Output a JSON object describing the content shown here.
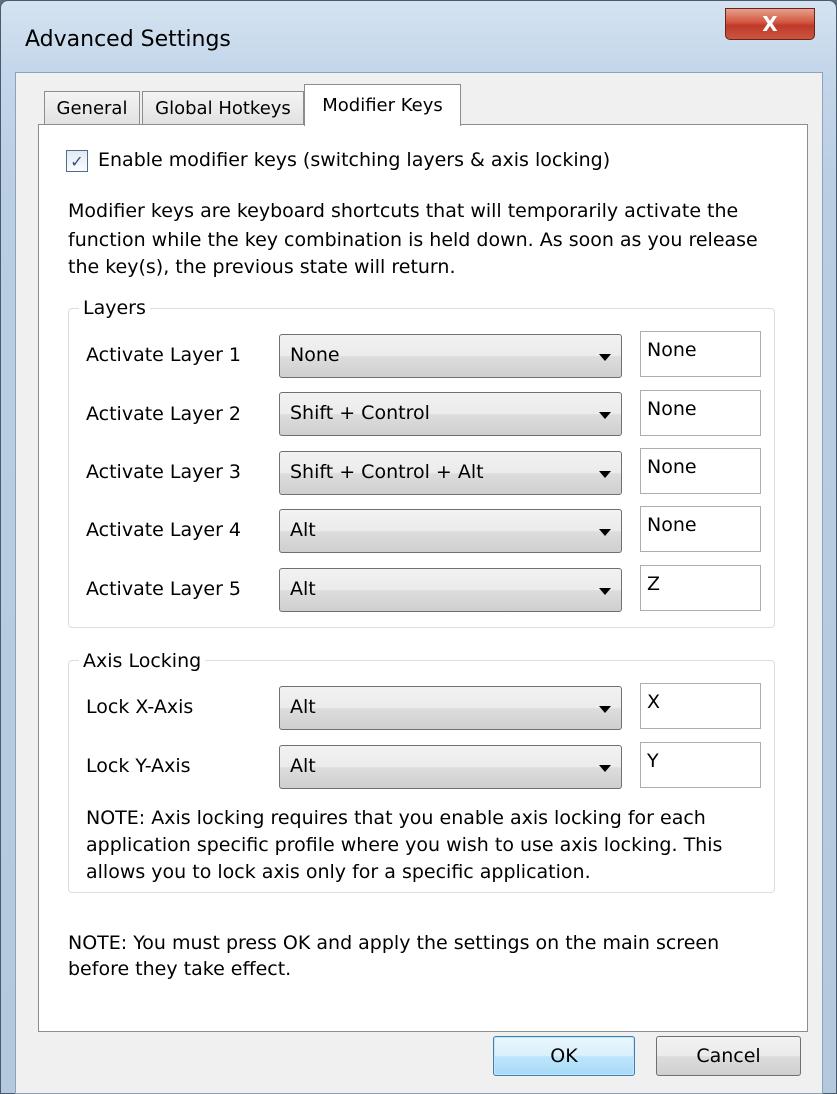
{
  "window": {
    "title": "Advanced Settings",
    "close_glyph": "X"
  },
  "tabs": [
    {
      "label": "General",
      "active": false
    },
    {
      "label": "Global Hotkeys",
      "active": false
    },
    {
      "label": "Modifier Keys",
      "active": true
    }
  ],
  "enable_checkbox": {
    "checked": true,
    "label": "Enable modifier keys (switching layers & axis locking)"
  },
  "description": [
    "Modifier keys are keyboard shortcuts that will temporarily activate the",
    "function while the key combination is held down. As soon as you release",
    "the key(s), the previous state will return."
  ],
  "layers": {
    "group_label": "Layers",
    "rows": [
      {
        "label": "Activate Layer 1",
        "modifier": "None",
        "key": "None"
      },
      {
        "label": "Activate Layer 2",
        "modifier": "Shift + Control",
        "key": "None"
      },
      {
        "label": "Activate Layer 3",
        "modifier": "Shift + Control + Alt",
        "key": "None"
      },
      {
        "label": "Activate Layer 4",
        "modifier": "Alt",
        "key": "None"
      },
      {
        "label": "Activate Layer 5",
        "modifier": "Alt",
        "key": "Z"
      }
    ]
  },
  "axis_locking": {
    "group_label": "Axis Locking",
    "rows": [
      {
        "label": "Lock X-Axis",
        "modifier": "Alt",
        "key": "X"
      },
      {
        "label": "Lock Y-Axis",
        "modifier": "Alt",
        "key": "Y"
      }
    ],
    "note": [
      "NOTE: Axis locking requires that you enable axis locking for each",
      "application specific profile where you wish to use axis locking. This",
      "allows you to lock axis only for a specific application."
    ]
  },
  "bottom_note": [
    "NOTE: You must press OK and apply the settings on the main screen",
    "before they take effect."
  ],
  "buttons": {
    "ok": "OK",
    "cancel": "Cancel"
  }
}
